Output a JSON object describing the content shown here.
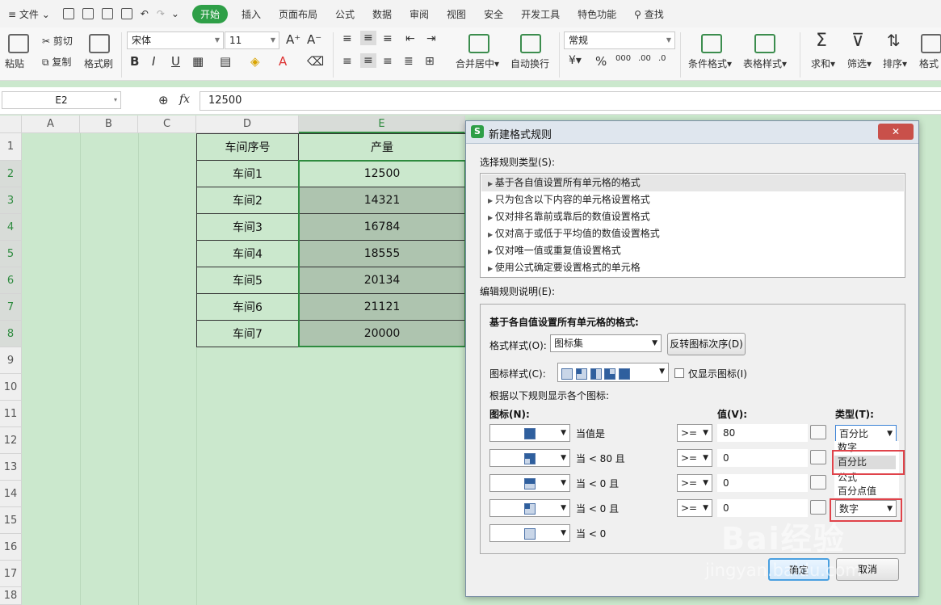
{
  "menu": {
    "file": "文件",
    "tabs": [
      "开始",
      "插入",
      "页面布局",
      "公式",
      "数据",
      "审阅",
      "视图",
      "安全",
      "开发工具",
      "特色功能"
    ],
    "search": "查找"
  },
  "ribbon": {
    "paste": "粘贴",
    "cut": "剪切",
    "copy": "复制",
    "format_painter": "格式刷",
    "font": "宋体",
    "size": "11",
    "merge": "合并居中",
    "wrap": "自动换行",
    "number_format": "常规",
    "cond_format": "条件格式",
    "table_style": "表格样式",
    "sum": "求和",
    "filter": "筛选",
    "sort": "排序",
    "format": "格式",
    "bold": "B",
    "italic": "I",
    "underline": "U",
    "percent": "%"
  },
  "formula_bar": {
    "cell_ref": "E2",
    "fx": "fx",
    "value": "12500"
  },
  "sheet": {
    "columns": [
      "A",
      "B",
      "C",
      "D",
      "E"
    ],
    "rows": [
      "1",
      "2",
      "3",
      "4",
      "5",
      "6",
      "7",
      "8",
      "9",
      "10",
      "11",
      "12",
      "13",
      "14",
      "15",
      "16",
      "17",
      "18"
    ],
    "header": [
      "车间序号",
      "产量"
    ],
    "data": [
      [
        "车间1",
        "12500"
      ],
      [
        "车间2",
        "14321"
      ],
      [
        "车间3",
        "16784"
      ],
      [
        "车间4",
        "18555"
      ],
      [
        "车间5",
        "20134"
      ],
      [
        "车间6",
        "21121"
      ],
      [
        "车间7",
        "20000"
      ]
    ]
  },
  "dialog": {
    "title": "新建格式规则",
    "select_type_label": "选择规则类型(S):",
    "rule_types": [
      "基于各自值设置所有单元格的格式",
      "只为包含以下内容的单元格设置格式",
      "仅对排名靠前或靠后的数值设置格式",
      "仅对高于或低于平均值的数值设置格式",
      "仅对唯一值或重复值设置格式",
      "使用公式确定要设置格式的单元格"
    ],
    "edit_label": "编辑规则说明(E):",
    "section_title": "基于各自值设置所有单元格的格式:",
    "format_style_label": "格式样式(O):",
    "format_style_value": "图标集",
    "reverse_button": "反转图标次序(D)",
    "icon_style_label": "图标样式(C):",
    "show_icon_only": "仅显示图标(I)",
    "rule_display_label": "根据以下规则显示各个图标:",
    "icon_col": "图标(N):",
    "value_col": "值(V):",
    "type_col": "类型(T):",
    "rows": [
      {
        "cond": "当值是",
        "op": ">=",
        "value": "80",
        "type": "百分比"
      },
      {
        "cond": "当 < 80 且",
        "op": ">=",
        "value": "0",
        "type": ""
      },
      {
        "cond": "当 < 0 且",
        "op": ">=",
        "value": "0",
        "type": ""
      },
      {
        "cond": "当 < 0 且",
        "op": ">=",
        "value": "0",
        "type": "数字"
      },
      {
        "cond": "当 < 0",
        "op": "",
        "value": "",
        "type": ""
      }
    ],
    "type_options": [
      "数字",
      "百分比",
      "公式",
      "百分点值"
    ],
    "ok": "确定",
    "cancel": "取消",
    "close": "✕"
  },
  "watermark": {
    "brand": "Bai经验",
    "url": "jingyan.baidu.com"
  }
}
